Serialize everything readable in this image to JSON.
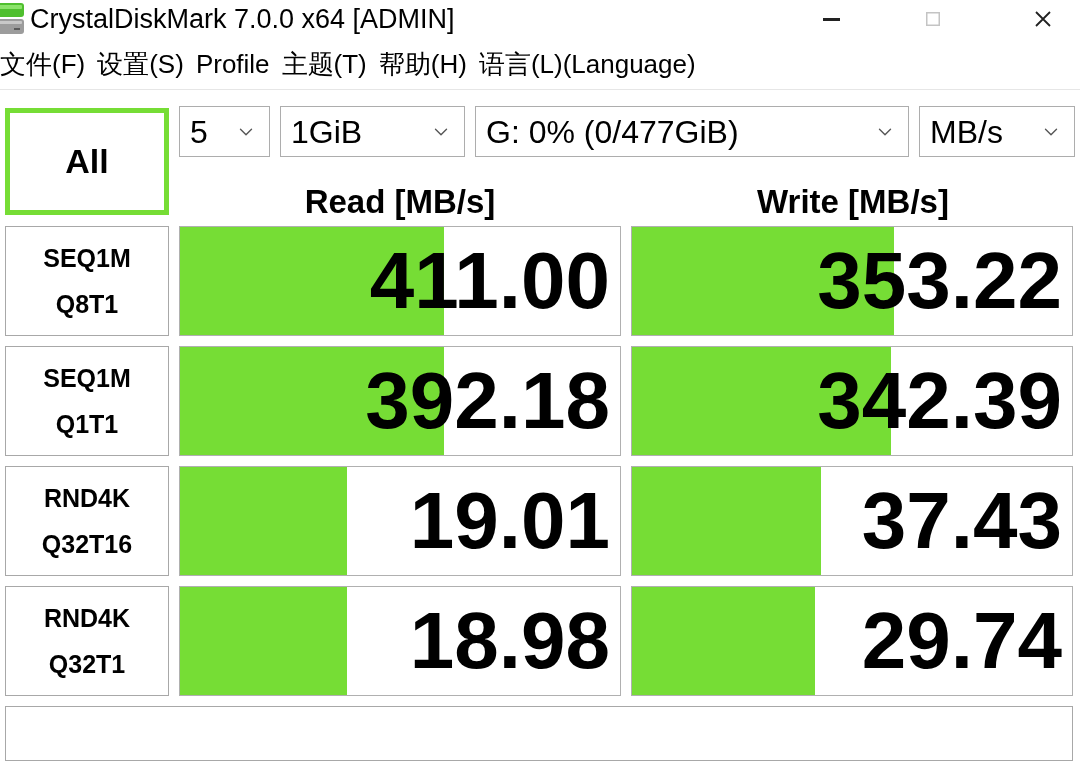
{
  "window": {
    "title": "CrystalDiskMark 7.0.0 x64 [ADMIN]",
    "controls": [
      {
        "kind": "minimize",
        "disabled": false
      },
      {
        "kind": "maximize",
        "disabled": true
      },
      {
        "kind": "close",
        "disabled": false
      }
    ]
  },
  "menu": [
    {
      "label": "文件(F)"
    },
    {
      "label": "设置(S)"
    },
    {
      "label": "Profile"
    },
    {
      "label": "主题(T)"
    },
    {
      "label": "帮助(H)"
    },
    {
      "label": "语言(L)(Language)"
    }
  ],
  "toolbar": {
    "all_button": "All",
    "selects": [
      {
        "value": "5"
      },
      {
        "value": "1GiB"
      },
      {
        "value": "G: 0% (0/477GiB)"
      },
      {
        "value": "MB/s"
      }
    ]
  },
  "columns": [
    "Read [MB/s]",
    "Write [MB/s]"
  ],
  "rows": [
    {
      "label": [
        "SEQ1M",
        "Q8T1"
      ],
      "results": [
        {
          "value": "411.00",
          "level": 0.6
        },
        {
          "value": "353.22",
          "level": 0.595
        }
      ]
    },
    {
      "label": [
        "SEQ1M",
        "Q1T1"
      ],
      "results": [
        {
          "value": "392.18",
          "level": 0.6
        },
        {
          "value": "342.39",
          "level": 0.588
        }
      ]
    },
    {
      "label": [
        "RND4K",
        "Q32T16"
      ],
      "results": [
        {
          "value": "19.01",
          "level": 0.38
        },
        {
          "value": "37.43",
          "level": 0.43
        }
      ]
    },
    {
      "label": [
        "RND4K",
        "Q32T1"
      ],
      "results": [
        {
          "value": "18.98",
          "level": 0.38
        },
        {
          "value": "29.74",
          "level": 0.415
        }
      ]
    }
  ]
}
